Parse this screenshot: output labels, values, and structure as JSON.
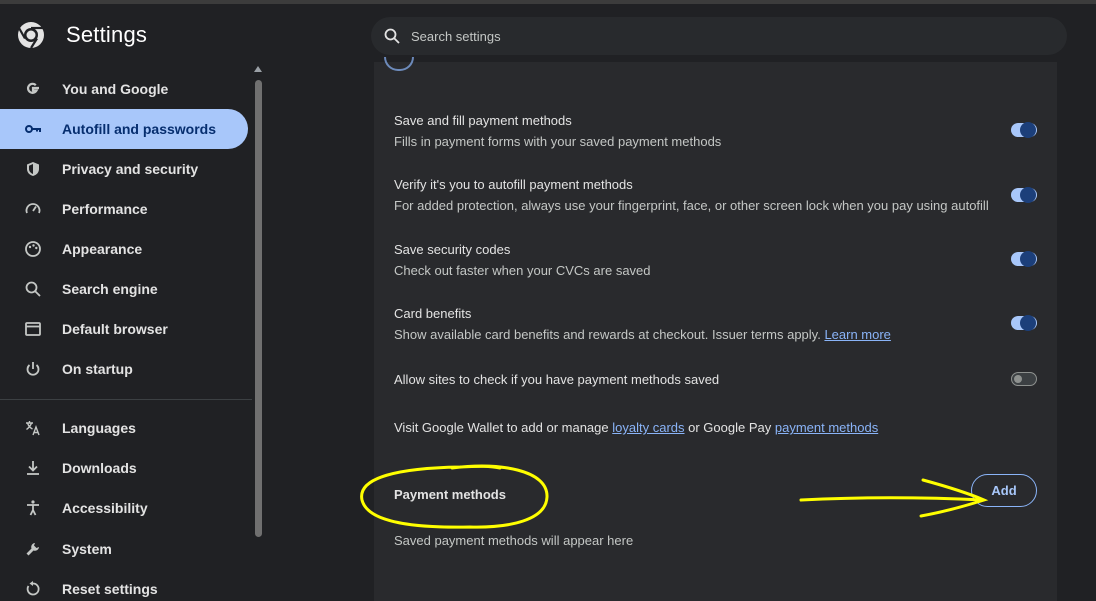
{
  "header": {
    "app_title": "Settings",
    "search_placeholder": "Search settings"
  },
  "sidebar": {
    "items": [
      {
        "label": "You and Google",
        "icon": "google-g-icon",
        "active": false
      },
      {
        "label": "Autofill and passwords",
        "icon": "key-icon",
        "active": true
      },
      {
        "label": "Privacy and security",
        "icon": "shield-icon",
        "active": false
      },
      {
        "label": "Performance",
        "icon": "speedometer-icon",
        "active": false
      },
      {
        "label": "Appearance",
        "icon": "palette-icon",
        "active": false
      },
      {
        "label": "Search engine",
        "icon": "search-icon",
        "active": false
      },
      {
        "label": "Default browser",
        "icon": "browser-window-icon",
        "active": false
      },
      {
        "label": "On startup",
        "icon": "power-icon",
        "active": false
      },
      {
        "label": "Languages",
        "icon": "translate-icon",
        "active": false
      },
      {
        "label": "Downloads",
        "icon": "download-icon",
        "active": false
      },
      {
        "label": "Accessibility",
        "icon": "accessibility-icon",
        "active": false
      },
      {
        "label": "System",
        "icon": "wrench-icon",
        "active": false
      },
      {
        "label": "Reset settings",
        "icon": "reset-icon",
        "active": false
      }
    ]
  },
  "main": {
    "settings": [
      {
        "title": "Save and fill payment methods",
        "description": "Fills in payment forms with your saved payment methods",
        "enabled": true
      },
      {
        "title": "Verify it's you to autofill payment methods",
        "description": "For added protection, always use your fingerprint, face, or other screen lock when you pay using autofill",
        "enabled": true
      },
      {
        "title": "Save security codes",
        "description": "Check out faster when your CVCs are saved",
        "enabled": true
      },
      {
        "title": "Card benefits",
        "description": "Show available card benefits and rewards at checkout. Issuer terms apply.",
        "link": "Learn more",
        "enabled": true
      },
      {
        "title": "Allow sites to check if you have payment methods saved",
        "enabled": false
      }
    ],
    "wallet": {
      "prefix": "Visit Google Wallet to add or manage",
      "link1": "loyalty cards",
      "middle": "or Google Pay",
      "link2": "payment methods"
    },
    "payment_methods": {
      "title": "Payment methods",
      "add_label": "Add",
      "empty_text": "Saved payment methods will appear here"
    }
  },
  "colors": {
    "accent": "#a8c7fa",
    "link": "#8ab4f8",
    "annotation": "#ffff00"
  }
}
